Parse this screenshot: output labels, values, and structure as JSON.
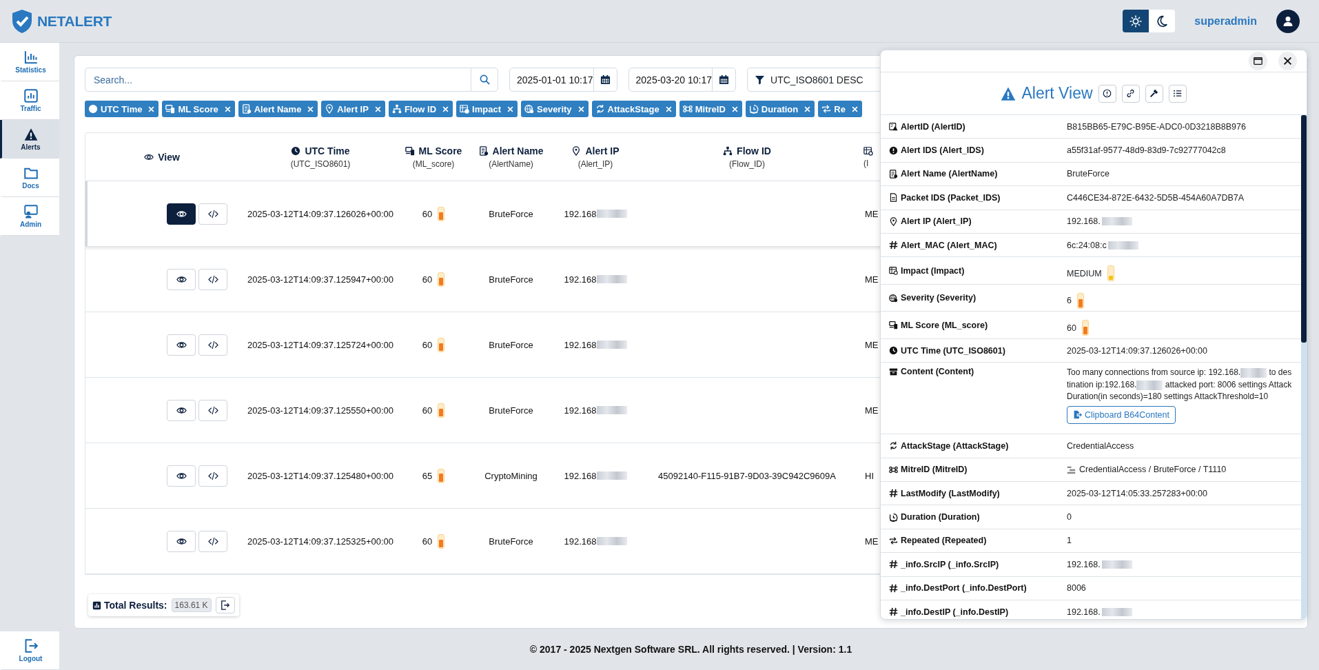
{
  "logo": {
    "text": "NETALERT"
  },
  "header": {
    "theme_modes": [
      {
        "kind": "light",
        "selected": true
      },
      {
        "kind": "dark",
        "selected": false
      }
    ],
    "username": "superadmin"
  },
  "sidebar": {
    "items": [
      {
        "label": "Statistics",
        "selected": false
      },
      {
        "label": "Traffic",
        "selected": false
      },
      {
        "label": "Alerts",
        "selected": true
      },
      {
        "label": "Docs",
        "selected": false
      },
      {
        "label": "Admin",
        "selected": false
      }
    ],
    "logout": "Logout"
  },
  "toolbar": {
    "search": {
      "placeholder": "Search..."
    },
    "date_from": "2025-01-01 10:17",
    "date_to": "2025-03-20 10:17",
    "sort": "UTC_ISO8601 DESC"
  },
  "column_chips": [
    {
      "label": "UTC Time"
    },
    {
      "label": "ML Score"
    },
    {
      "label": "Alert Name"
    },
    {
      "label": "Alert IP"
    },
    {
      "label": "Flow ID"
    },
    {
      "label": "Impact"
    },
    {
      "label": "Severity"
    },
    {
      "label": "AttackStage"
    },
    {
      "label": "MitreID"
    },
    {
      "label": "Duration"
    },
    {
      "label": "Re"
    }
  ],
  "table": {
    "columns": [
      {
        "label": "View"
      },
      {
        "label": "UTC Time",
        "field": "(UTC_ISO8601)"
      },
      {
        "label": "ML Score",
        "field": "(ML_score)"
      },
      {
        "label": "Alert Name",
        "field": "(AlertName)"
      },
      {
        "label": "Alert IP",
        "field": "(Alert_IP)"
      },
      {
        "label": "Flow ID",
        "field": "(Flow_ID)"
      },
      {
        "field": "(I"
      }
    ],
    "rows": [
      {
        "selected": true,
        "utc_time": "2025-03-12T14:09:37.126026+00:00",
        "ml_score": {
          "value": "60",
          "level": 0.6
        },
        "alert_name": "BruteForce",
        "alert_ip": {
          "text": "192.168",
          "redacted": true
        },
        "impact": "ME"
      },
      {
        "selected": false,
        "utc_time": "2025-03-12T14:09:37.125947+00:00",
        "ml_score": {
          "value": "60",
          "level": 0.6
        },
        "alert_name": "BruteForce",
        "alert_ip": {
          "text": "192.168",
          "redacted": true
        },
        "impact": "ME"
      },
      {
        "selected": false,
        "utc_time": "2025-03-12T14:09:37.125724+00:00",
        "ml_score": {
          "value": "60",
          "level": 0.6
        },
        "alert_name": "BruteForce",
        "alert_ip": {
          "text": "192.168",
          "redacted": true
        },
        "impact": "ME"
      },
      {
        "selected": false,
        "utc_time": "2025-03-12T14:09:37.125550+00:00",
        "ml_score": {
          "value": "60",
          "level": 0.6
        },
        "alert_name": "BruteForce",
        "alert_ip": {
          "text": "192.168",
          "redacted": true
        },
        "impact": "ME"
      },
      {
        "selected": false,
        "utc_time": "2025-03-12T14:09:37.125480+00:00",
        "ml_score": {
          "value": "65",
          "level": 0.65
        },
        "alert_name": "CryptoMining",
        "alert_ip": {
          "text": "192.168",
          "redacted": true
        },
        "flow_id": "45092140-F115-91B7-9D03-39C942C9609A",
        "impact": "HI"
      },
      {
        "selected": false,
        "utc_time": "2025-03-12T14:09:37.125325+00:00",
        "ml_score": {
          "value": "60",
          "level": 0.6
        },
        "alert_name": "BruteForce",
        "alert_ip": {
          "text": "192.168",
          "redacted": true
        },
        "impact": "ME"
      }
    ]
  },
  "totals": {
    "label": "Total Results:",
    "value": "163.61 K"
  },
  "detail_panel": {
    "title": "Alert View",
    "rows": [
      {
        "kind": "text",
        "label": "AlertID (AlertID)",
        "value": "B815BB65-E79C-B95E-ADC0-0D3218B8B976",
        "redacted": false
      },
      {
        "kind": "text",
        "label": "Alert IDS (Alert_IDS)",
        "value": "a55f31af-9577-48d9-83d9-7c92777042c8",
        "redacted": false
      },
      {
        "kind": "text",
        "label": "Alert Name (AlertName)",
        "value": "BruteForce",
        "redacted": false
      },
      {
        "kind": "text",
        "label": "Packet IDS (Packet_IDS)",
        "value": "C446CE34-872E-6432-5D5B-454A60A7DB7A",
        "redacted": false
      },
      {
        "kind": "text",
        "label": "Alert IP (Alert_IP)",
        "value": "192.168.",
        "redacted": true
      },
      {
        "kind": "text",
        "label": "Alert_MAC (Alert_MAC)",
        "value": "6c:24:08:c",
        "redacted": true
      },
      {
        "kind": "meter",
        "label": "Impact (Impact)",
        "value": "MEDIUM",
        "level": 0.3,
        "color": "#f5c211"
      },
      {
        "kind": "meter",
        "label": "Severity (Severity)",
        "value": "6",
        "level": 0.6,
        "color": "#f47a1f"
      },
      {
        "kind": "meter",
        "label": "ML Score (ML_score)",
        "value": "60",
        "level": 0.6,
        "color": "#f47a1f"
      },
      {
        "kind": "text",
        "label": "UTC Time (UTC_ISO8601)",
        "value": "2025-03-12T14:09:37.126026+00:00",
        "redacted": false
      },
      {
        "kind": "content",
        "label": "Content (Content)",
        "parts": [
          "Too many connections from source ip: 192.168.",
          "to destination ip:192.168.",
          "attacked port: 8006 settings AttackDuration(in seconds)=180 settings AttackThreshold=10"
        ],
        "button": "Clipboard B64Content"
      },
      {
        "kind": "text",
        "label": "AttackStage (AttackStage)",
        "value": "CredentialAccess",
        "redacted": false
      },
      {
        "kind": "mitre",
        "label": "MitreID (MitreID)",
        "value": "CredentialAccess / BruteForce / T1110"
      },
      {
        "kind": "text",
        "label": "LastModify (LastModify)",
        "value": "2025-03-12T14:05:33.257283+00:00",
        "redacted": false
      },
      {
        "kind": "text",
        "label": "Duration (Duration)",
        "value": "0",
        "redacted": false
      },
      {
        "kind": "text",
        "label": "Repeated (Repeated)",
        "value": "1",
        "redacted": false
      },
      {
        "kind": "text",
        "label": "_info.SrcIP (_info.SrcIP)",
        "value": "192.168.",
        "redacted": true
      },
      {
        "kind": "text",
        "label": "_info.DestPort (_info.DestPort)",
        "value": "8006",
        "redacted": false
      },
      {
        "kind": "text",
        "label": "_info.DestIP (_info.DestIP)",
        "value": "192.168.",
        "redacted": true
      }
    ]
  },
  "footer": "© 2017 - 2025 Nextgen Software SRL. All rights reserved. | Version: 1.1"
}
